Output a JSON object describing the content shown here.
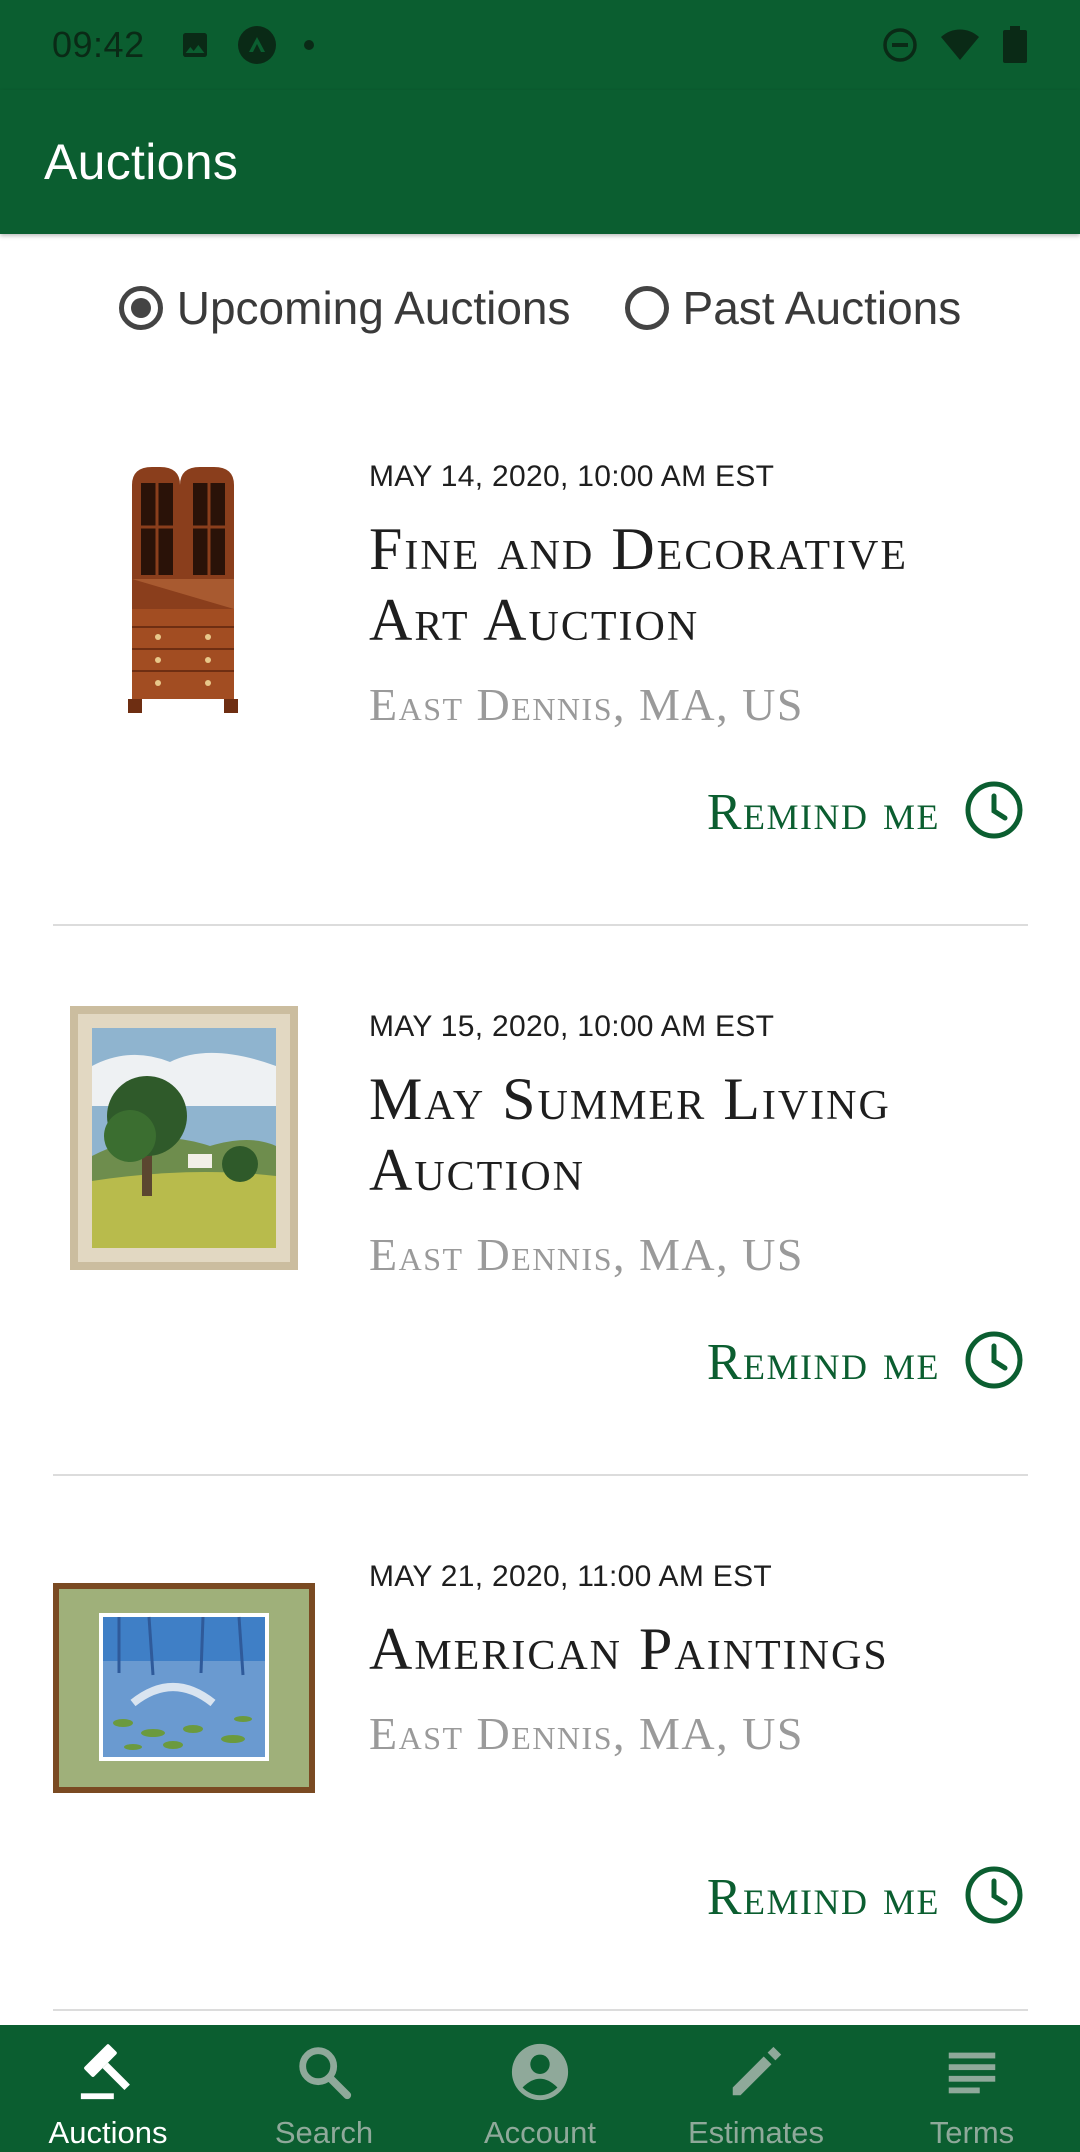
{
  "status_bar": {
    "time": "09:42",
    "left_icons": [
      "image-icon",
      "app-notification-icon",
      "dot-icon"
    ],
    "right_icons": [
      "do-not-disturb-icon",
      "wifi-icon",
      "battery-icon"
    ]
  },
  "app_bar": {
    "title": "Auctions"
  },
  "filter": {
    "options": [
      {
        "label": "Upcoming Auctions",
        "selected": true
      },
      {
        "label": "Past Auctions",
        "selected": false
      }
    ]
  },
  "auctions": [
    {
      "date": "MAY 14, 2020, 10:00 AM EST",
      "title_line1": "Fine and Decorative",
      "title_line2": "Art Auction",
      "location": "East Dennis, MA, US",
      "remind_label": "Remind me",
      "thumbnail": "secretary-desk-image"
    },
    {
      "date": "MAY 15, 2020, 10:00 AM EST",
      "title_line1": "May Summer Living",
      "title_line2": "Auction",
      "location": "East Dennis, MA, US",
      "remind_label": "Remind me",
      "thumbnail": "landscape-painting-image"
    },
    {
      "date": "MAY 21, 2020, 11:00 AM EST",
      "title_line1": "American Paintings",
      "title_line2": "",
      "location": "East Dennis, MA, US",
      "remind_label": "Remind me",
      "thumbnail": "water-lily-painting-image"
    }
  ],
  "bottom_nav": {
    "items": [
      {
        "label": "Auctions",
        "icon": "gavel-icon",
        "active": true
      },
      {
        "label": "Search",
        "icon": "search-icon",
        "active": false
      },
      {
        "label": "Account",
        "icon": "account-icon",
        "active": false
      },
      {
        "label": "Estimates",
        "icon": "pencil-icon",
        "active": false
      },
      {
        "label": "Terms",
        "icon": "list-icon",
        "active": false
      }
    ]
  },
  "colors": {
    "brand_green": "#0b5e30",
    "text_dark": "#1e1e1e",
    "text_muted": "#9a9a9a",
    "nav_inactive": "#8fa99a"
  }
}
